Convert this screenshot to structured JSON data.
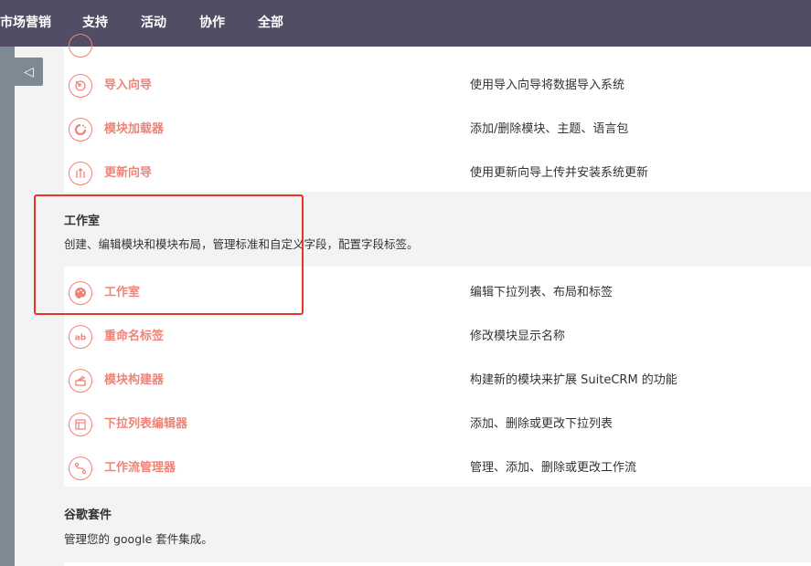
{
  "topnav": {
    "items": [
      "市场营销",
      "支持",
      "活动",
      "协作",
      "全部"
    ]
  },
  "sidebar": {
    "toggle_glyph": "◁",
    "toggle_icon": "collapse-arrow-icon"
  },
  "admin_rows_top": [
    {
      "title": "导入向导",
      "description": "使用导入向导将数据导入系统",
      "icon": "import-icon"
    },
    {
      "title": "模块加载器",
      "description": "添加/删除模块、主题、语言包",
      "icon": "module-loader-icon"
    },
    {
      "title": "更新向导",
      "description": "使用更新向导上传并安装系统更新",
      "icon": "upgrade-icon"
    }
  ],
  "studio_section": {
    "title": "工作室",
    "description": "创建、编辑模块和模块布局，管理标准和自定义字段，配置字段标签。",
    "rows": [
      {
        "title": "工作室",
        "description": "编辑下拉列表、布局和标签",
        "icon": "palette-icon"
      },
      {
        "title": "重命名标签",
        "description": "修改模块显示名称",
        "icon": "ab-rename-icon"
      },
      {
        "title": "模块构建器",
        "description": "构建新的模块来扩展 SuiteCRM 的功能",
        "icon": "module-builder-icon"
      },
      {
        "title": "下拉列表编辑器",
        "description": "添加、删除或更改下拉列表",
        "icon": "dropdown-editor-icon"
      },
      {
        "title": "工作流管理器",
        "description": "管理、添加、删除或更改工作流",
        "icon": "workflow-icon"
      }
    ]
  },
  "google_section": {
    "title": "谷歌套件",
    "description": "管理您的 google 套件集成。"
  },
  "colors": {
    "topnav_bg": "#524c64",
    "accent": "#f08377",
    "highlight_border": "#e8342a",
    "sidebar": "#7e8a93"
  }
}
